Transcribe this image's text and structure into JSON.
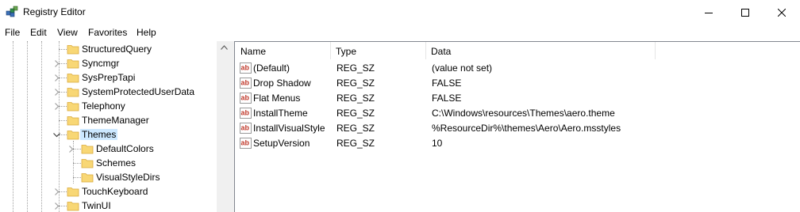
{
  "window": {
    "title": "Registry Editor",
    "icon": "registry-editor-icon",
    "controls": [
      "minimize-icon",
      "maximize-icon",
      "close-icon"
    ]
  },
  "menu": [
    "File",
    "Edit",
    "View",
    "Favorites",
    "Help"
  ],
  "tree": {
    "items": [
      {
        "label": "StructuredQuery",
        "expander": "none",
        "depth": 0
      },
      {
        "label": "Syncmgr",
        "expander": "collapsed",
        "depth": 0
      },
      {
        "label": "SysPrepTapi",
        "expander": "collapsed",
        "depth": 0
      },
      {
        "label": "SystemProtectedUserData",
        "expander": "collapsed",
        "depth": 0
      },
      {
        "label": "Telephony",
        "expander": "collapsed",
        "depth": 0
      },
      {
        "label": "ThemeManager",
        "expander": "none",
        "depth": 0
      },
      {
        "label": "Themes",
        "expander": "expanded",
        "depth": 0,
        "selected": true
      },
      {
        "label": "DefaultColors",
        "expander": "collapsed",
        "depth": 1
      },
      {
        "label": "Schemes",
        "expander": "none",
        "depth": 1
      },
      {
        "label": "VisualStyleDirs",
        "expander": "none",
        "depth": 1
      },
      {
        "label": "TouchKeyboard",
        "expander": "collapsed",
        "depth": 0
      },
      {
        "label": "TwinUI",
        "expander": "collapsed",
        "depth": 0
      }
    ]
  },
  "values": {
    "columns": {
      "name": "Name",
      "type": "Type",
      "data": "Data"
    },
    "rows": [
      {
        "name": "(Default)",
        "type": "REG_SZ",
        "data": "(value not set)"
      },
      {
        "name": "Drop Shadow",
        "type": "REG_SZ",
        "data": "FALSE"
      },
      {
        "name": "Flat Menus",
        "type": "REG_SZ",
        "data": "FALSE"
      },
      {
        "name": "InstallTheme",
        "type": "REG_SZ",
        "data": "C:\\Windows\\resources\\Themes\\aero.theme"
      },
      {
        "name": "InstallVisualStyle",
        "type": "REG_SZ",
        "data": "%ResourceDir%\\themes\\Aero\\Aero.msstyles"
      },
      {
        "name": "SetupVersion",
        "type": "REG_SZ",
        "data": "10"
      }
    ],
    "value_icon": "string-value-ab-icon"
  },
  "colors": {
    "selection": "#cce8ff",
    "folder": "#f8d775",
    "value_icon_red": "#c0392b"
  }
}
